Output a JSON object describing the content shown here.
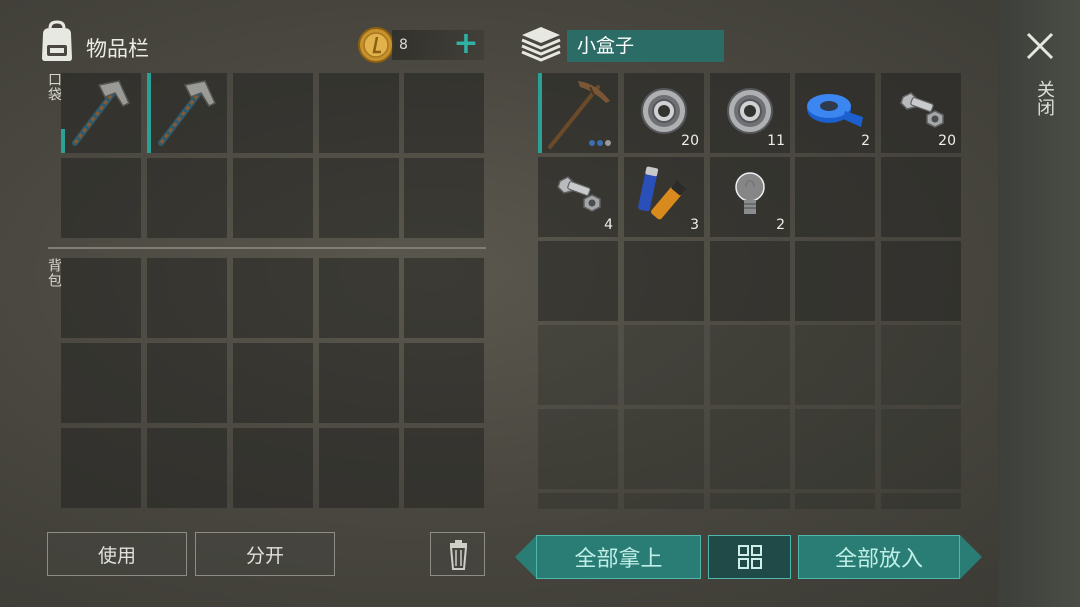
{
  "inventory": {
    "title": "物品栏",
    "coins": "8",
    "plus_label": "+",
    "pocket_label": "口袋",
    "backpack_label": "背包",
    "pocket_slots": [
      {
        "item": "pickaxe-hammer",
        "qty": ""
      },
      {
        "item": "pickaxe-hammer",
        "qty": ""
      }
    ]
  },
  "buttons": {
    "use": "使用",
    "split": "分开",
    "take_all": "全部拿上",
    "put_all": "全部放入"
  },
  "container": {
    "name": "小盒子",
    "close_label": "关闭",
    "slots": [
      {
        "item": "stone-pickaxe",
        "qty": ""
      },
      {
        "item": "bearing",
        "qty": "20"
      },
      {
        "item": "bearing",
        "qty": "11"
      },
      {
        "item": "blue-tape",
        "qty": "2"
      },
      {
        "item": "bolt-nut",
        "qty": "20"
      },
      {
        "item": "bolt-nut",
        "qty": "4"
      },
      {
        "item": "batteries",
        "qty": "3"
      },
      {
        "item": "light-bulb",
        "qty": "2"
      }
    ]
  },
  "colors": {
    "accent": "#2aa196",
    "teal_button": "#2a7d75",
    "name_field": "#2c6c67"
  }
}
